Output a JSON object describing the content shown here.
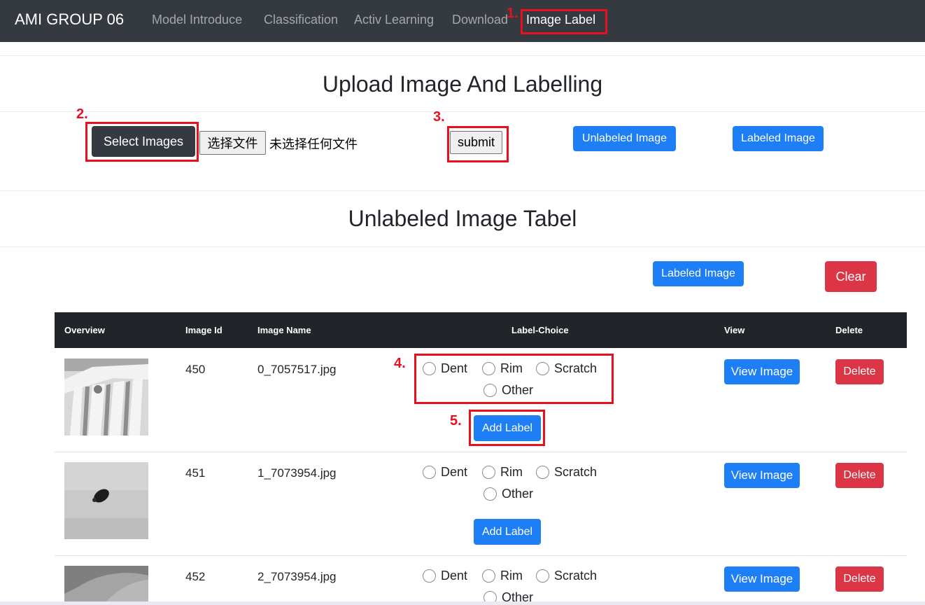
{
  "navbar": {
    "brand": "AMI GROUP 06",
    "items": [
      {
        "label": "Model Introduce"
      },
      {
        "label": "Classification"
      },
      {
        "label": "Activ Learning"
      },
      {
        "label": "Download"
      },
      {
        "label": "Image Label"
      }
    ]
  },
  "annotations": {
    "one": "1.",
    "two": "2.",
    "three": "3.",
    "four": "4.",
    "five": "5.",
    "color": "#e8101f"
  },
  "upload": {
    "title": "Upload Image And Labelling",
    "select_label": "Select Images",
    "file_button": "选择文件",
    "file_status": "未选择任何文件",
    "submit_label": "submit",
    "unlabeled_btn": "Unlabeled Image",
    "labeled_btn": "Labeled Image"
  },
  "table_section": {
    "title": "Unlabeled Image Tabel",
    "labeled_btn": "Labeled Image",
    "clear_btn": "Clear"
  },
  "table": {
    "headers": {
      "overview": "Overview",
      "image_id": "Image Id",
      "image_name": "Image Name",
      "label_choice": "Label-Choice",
      "view": "View",
      "delete": "Delete"
    },
    "label_options": [
      "Dent",
      "Rim",
      "Scratch",
      "Other"
    ],
    "add_label": "Add Label",
    "view_btn": "View Image",
    "delete_btn": "Delete",
    "rows": [
      {
        "id": "450",
        "name": "0_7057517.jpg"
      },
      {
        "id": "451",
        "name": "1_7073954.jpg"
      },
      {
        "id": "452",
        "name": "2_7073954.jpg"
      }
    ]
  },
  "colors": {
    "navbar": "#343a40",
    "primary": "#1e7ef5",
    "danger": "#dc3545",
    "table_header": "#212529"
  }
}
